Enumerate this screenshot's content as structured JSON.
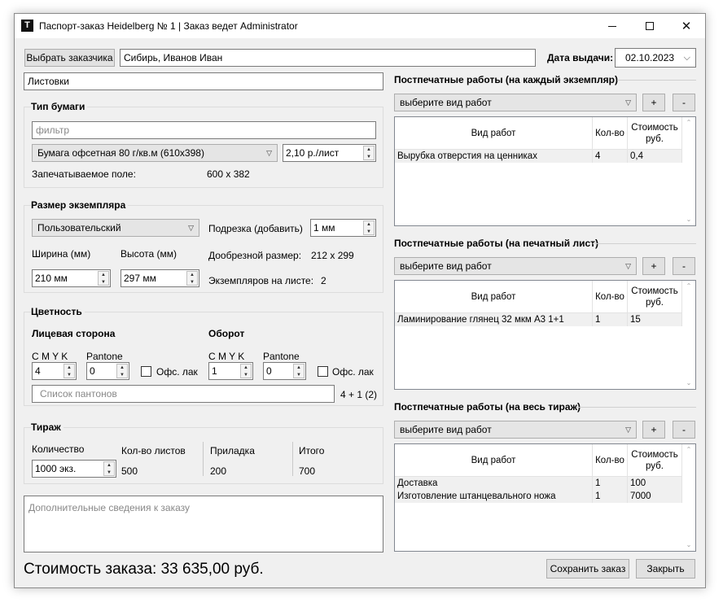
{
  "window": {
    "title": "Паспорт-заказ Heidelberg № 1 | Заказ ведет Administrator",
    "app_icon_glyph": "T"
  },
  "customer": {
    "button_label": "Выбрать заказчика",
    "value": "Сибирь, Иванов Иван"
  },
  "issue_date": {
    "label": "Дата выдачи:",
    "value": "02.10.2023"
  },
  "product": {
    "value": "Листовки"
  },
  "paper": {
    "title": "Тип бумаги",
    "filter_placeholder": "фильтр",
    "selected": "Бумага офсетная 80 г/кв.м (610x398)",
    "price": "2,10 р./лист",
    "print_field_label": "Запечатываемое поле:",
    "print_field_value": "600 x 382"
  },
  "size": {
    "title": "Размер экземпляра",
    "format": "Пользовательский",
    "trim_label": "Подрезка (добавить)",
    "trim_value": "1 мм",
    "width_label": "Ширина (мм)",
    "width_value": "210 мм",
    "height_label": "Высота (мм)",
    "height_value": "297 мм",
    "pretrim_label": "Дообрезной размер:",
    "pretrim_value": "212 x 299",
    "per_sheet_label": "Экземпляров на листе:",
    "per_sheet_value": "2"
  },
  "color": {
    "title": "Цветность",
    "front_title": "Лицевая сторона",
    "back_title": "Оборот",
    "cmyk_label": "C M Y K",
    "pantone_label": "Pantone",
    "lacquer_label": "Офс. лак",
    "front_cmyk": "4",
    "front_pantone": "0",
    "back_cmyk": "1",
    "back_pantone": "0",
    "pantone_list_placeholder": "Список пантонов",
    "formula": "4 + 1 (2)"
  },
  "run": {
    "title": "Тираж",
    "qty_label": "Количество",
    "qty_value": "1000 экз.",
    "sheets_label": "Кол-во листов",
    "sheets_value": "500",
    "makeready_label": "Приладка",
    "makeready_value": "200",
    "total_label": "Итого",
    "total_value": "700"
  },
  "notes": {
    "placeholder": "Дополнительные сведения к заказу"
  },
  "order_cost": "Стоимость заказа: 33 635,00 руб.",
  "buttons": {
    "save": "Сохранить заказ",
    "close": "Закрыть",
    "add": "+",
    "remove": "-"
  },
  "postpress": {
    "column_headers": {
      "work": "Вид работ",
      "qty": "Кол-во",
      "cost": "Стоимость руб."
    },
    "select_placeholder": "выберите вид работ",
    "sections": [
      {
        "title": "Постпечатные работы (на  каждый экземпляр)",
        "rows": [
          {
            "work": "Вырубка отверстия на ценниках",
            "qty": "4",
            "cost": "0,4"
          }
        ]
      },
      {
        "title": "Постпечатные работы (на печатный лист)",
        "rows": [
          {
            "work": "Ламинирование глянец 32 мкм А3 1+1",
            "qty": "1",
            "cost": "15"
          }
        ]
      },
      {
        "title": "Постпечатные работы (на весь тираж)",
        "rows": [
          {
            "work": "Доставка",
            "qty": "1",
            "cost": "100"
          },
          {
            "work": "Изготовление штанцевального ножа",
            "qty": "1",
            "cost": "7000"
          }
        ]
      }
    ]
  }
}
